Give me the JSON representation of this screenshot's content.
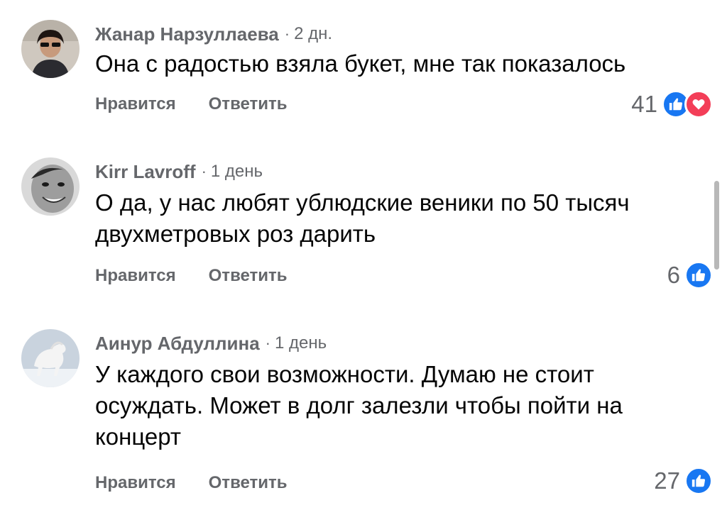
{
  "labels": {
    "like": "Нравится",
    "reply": "Ответить"
  },
  "comments": [
    {
      "author": "Жанар Нарзуллаева",
      "time": "2 дн.",
      "text": "Она с радостью взяла букет, мне так показалось",
      "reaction_count": "41",
      "reactions": [
        "like-icon",
        "love-icon"
      ]
    },
    {
      "author": "Kirr Lavroff",
      "time": "1 день",
      "text": "О да, у нас любят ублюдские веники по 50 тысяч двухметровых роз дарить",
      "reaction_count": "6",
      "reactions": [
        "like-icon"
      ]
    },
    {
      "author": "Аинур Абдуллина",
      "time": "1 день",
      "text": "У каждого свои возможности. Думаю не стоит осуждать. Может в долг залезли чтобы пойти на концерт",
      "reaction_count": "27",
      "reactions": [
        "like-icon"
      ]
    }
  ],
  "colors": {
    "secondary_text": "#65676b",
    "primary_text": "#050505",
    "like_blue": "#1877f2",
    "love_red": "#f33e58"
  }
}
